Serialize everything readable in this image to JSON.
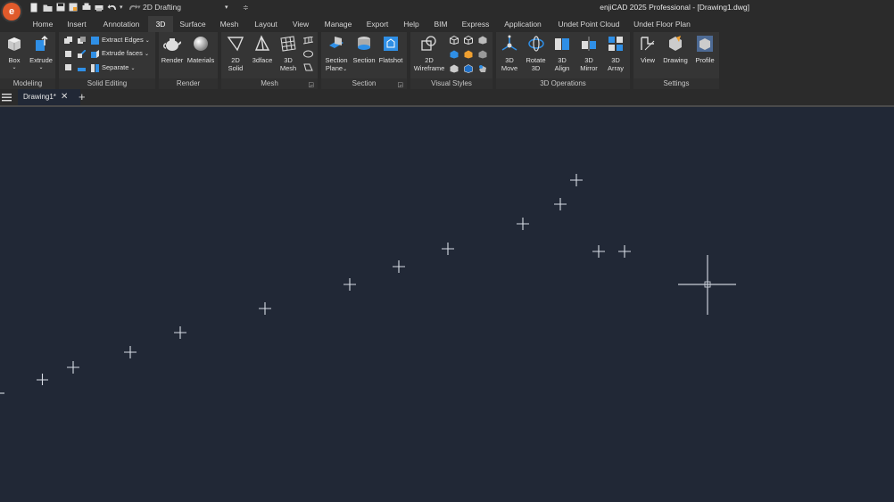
{
  "app": {
    "logo_letter": "e",
    "workspace": "2D Drafting",
    "title": "enjiCAD 2025 Professional - [Drawing1.dwg]"
  },
  "quick_access": [
    "new-icon",
    "open-icon",
    "save-icon",
    "save-as-icon",
    "print-icon",
    "plot-icon",
    "undo-icon",
    "redo-icon"
  ],
  "menu_tabs": [
    "Home",
    "Insert",
    "Annotation",
    "3D",
    "Surface",
    "Mesh",
    "Layout",
    "View",
    "Manage",
    "Export",
    "Help",
    "BIM",
    "Express",
    "Application",
    "Undet Point Cloud",
    "Undet Floor Plan"
  ],
  "active_tab": "3D",
  "ribbon": {
    "modeling": {
      "title": "Modeling",
      "box": "Box",
      "extrude": "Extrude"
    },
    "solid_editing": {
      "title": "Solid Editing",
      "extract_edges": "Extract Edges",
      "extrude_faces": "Extrude faces",
      "separate": "Separate"
    },
    "render": {
      "title": "Render",
      "render": "Render",
      "materials": "Materials"
    },
    "mesh": {
      "title": "Mesh",
      "solid2d_l1": "2D",
      "solid2d_l2": "Solid",
      "face3d": "3dface",
      "mesh3d_l1": "3D",
      "mesh3d_l2": "Mesh"
    },
    "section": {
      "title": "Section",
      "plane_l1": "Section",
      "plane_l2": "Plane",
      "section": "Section",
      "flatshot": "Flatshot"
    },
    "visual_styles": {
      "title": "Visual Styles",
      "wire_l1": "2D",
      "wire_l2": "Wireframe"
    },
    "ops3d": {
      "title": "3D Operations",
      "move_l1": "3D",
      "move_l2": "Move",
      "rotate_l1": "Rotate",
      "rotate_l2": "3D",
      "align_l1": "3D",
      "align_l2": "Align",
      "mirror_l1": "3D",
      "mirror_l2": "Mirror",
      "array_l1": "3D",
      "array_l2": "Array"
    },
    "settings": {
      "title": "Settings",
      "view": "View",
      "drawing": "Drawing",
      "profile": "Profile"
    }
  },
  "drawing_tab": {
    "label": "Drawing1*"
  },
  "colors": {
    "accent": "#e05a2b",
    "canvas": "#212836",
    "ribbon": "#353535",
    "icon_blue": "#2f8fe6",
    "icon_orange": "#f0a030"
  }
}
